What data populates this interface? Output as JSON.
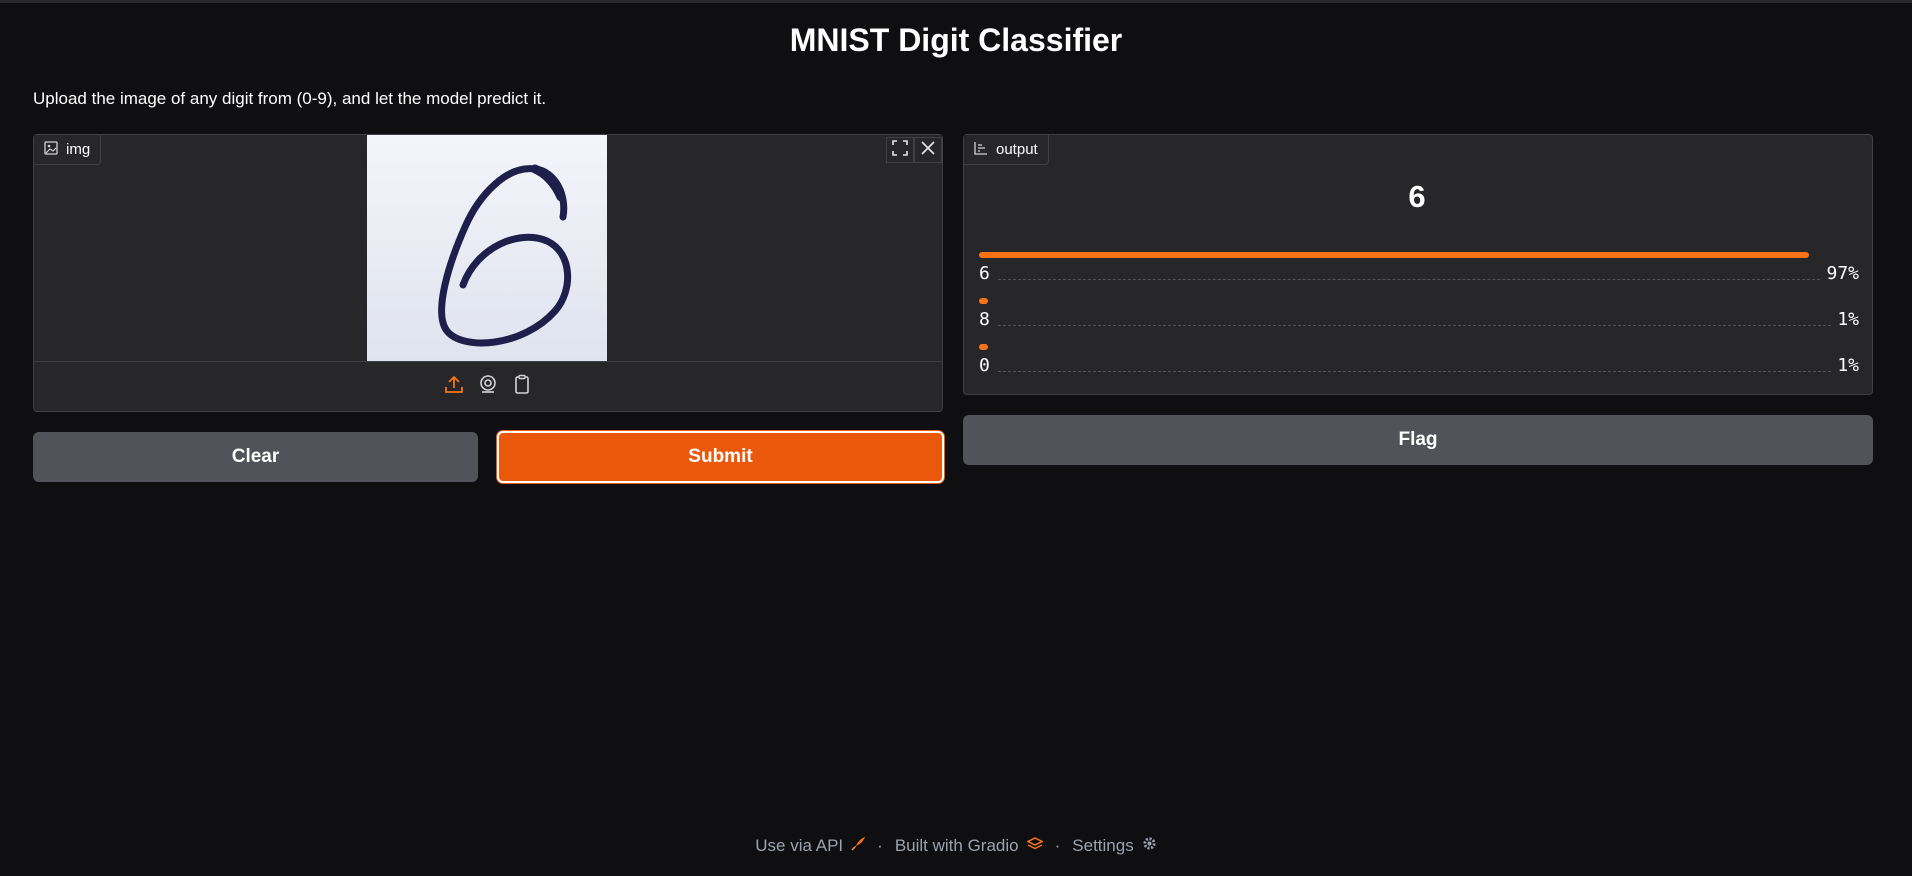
{
  "header": {
    "title": "MNIST Digit Classifier",
    "description": "Upload the image of any digit from (0-9), and let the model predict it."
  },
  "input": {
    "label": "img",
    "label_icon": "image-icon",
    "controls": [
      "fullscreen-icon",
      "close-icon"
    ],
    "sources": [
      "upload-icon",
      "webcam-icon",
      "clipboard-icon"
    ],
    "image_alt": "handwritten digit 6"
  },
  "output": {
    "label": "output",
    "label_icon": "bar-chart-icon",
    "predicted": "6",
    "confidences": [
      {
        "label": "6",
        "value": 0.97,
        "text": "97%"
      },
      {
        "label": "8",
        "value": 0.01,
        "text": "1%"
      },
      {
        "label": "0",
        "value": 0.01,
        "text": "1%"
      }
    ]
  },
  "buttons": {
    "clear": "Clear",
    "submit": "Submit",
    "flag": "Flag"
  },
  "footer": {
    "api": "Use via API",
    "built": "Built with Gradio",
    "settings": "Settings",
    "separator": "·"
  },
  "colors": {
    "accent": "#ea580c",
    "bar": "#f97316",
    "background": "#0f0f11",
    "panel": "#27272a"
  }
}
